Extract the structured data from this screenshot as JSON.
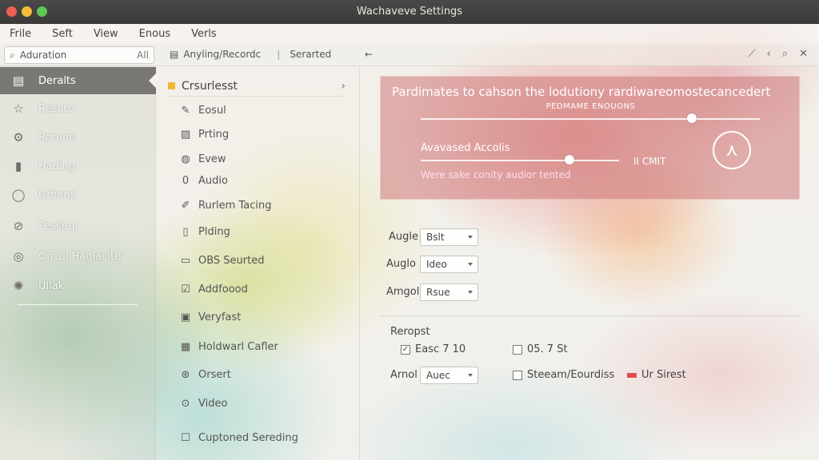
{
  "window": {
    "title": "Wachaveve Settings"
  },
  "menu": [
    "Frile",
    "Seft",
    "View",
    "Enous",
    "Verls"
  ],
  "toolbar": {
    "search_value": "Aduration",
    "search_scope": "All",
    "crumb1": "Anyling/Recordc",
    "crumb2": "Serarted"
  },
  "sidebar": {
    "items": [
      {
        "label": "Deralts",
        "icon": "list-icon"
      },
      {
        "label": "Resure",
        "icon": "star-icon"
      },
      {
        "label": "Rerune",
        "icon": "gear-icon"
      },
      {
        "label": "Hading",
        "icon": "clipboard-icon"
      },
      {
        "label": "Grhens",
        "icon": "circle-icon"
      },
      {
        "label": "Pessital",
        "icon": "compass-icon"
      },
      {
        "label": "Oncul Hagiacite",
        "icon": "dial-icon"
      },
      {
        "label": "Ullak",
        "icon": "sun-icon"
      }
    ]
  },
  "midlist": {
    "header": "Crsurlesst",
    "items": [
      {
        "label": "Eosul",
        "icon": "pen-icon"
      },
      {
        "label": "Prting",
        "icon": "image-icon"
      },
      {
        "label": "Evew",
        "icon": "globe-icon"
      },
      {
        "label": "Audio",
        "icon": "mic-icon"
      },
      {
        "label": "Rurlem Tacing",
        "icon": "brush-icon"
      },
      {
        "label": "Plding",
        "icon": "tag-icon"
      },
      {
        "label": "OBS Seurted",
        "icon": "obs-icon"
      },
      {
        "label": "Addfoood",
        "icon": "edit-icon"
      },
      {
        "label": "Veryfast",
        "icon": "layers-icon"
      },
      {
        "label": "Holdwarl Cafler",
        "icon": "grid-icon"
      },
      {
        "label": "Orsert",
        "icon": "badge-icon"
      },
      {
        "label": "Video",
        "icon": "video-icon"
      },
      {
        "label": "Cuptoned Sereding",
        "icon": "square-icon"
      }
    ]
  },
  "hero": {
    "title": "Pardimates to cahson the lodutiony rardiwareomostecancedert",
    "subtitle": "PEDMAME ENOUONS",
    "slider_label": "Avavased Accolis",
    "note": "Were sake conity audior tented",
    "limit": "II CMIT",
    "top_slider_level": 0.8,
    "bottom_slider_level": 0.75
  },
  "fields": [
    {
      "label": "Augle",
      "value": "Bslt"
    },
    {
      "label": "Auglo",
      "value": "Ideo"
    },
    {
      "label": "Amgol",
      "value": "Rsue"
    }
  ],
  "bottom": {
    "section": "Reropst",
    "check1": "Easc 7 10",
    "check1_mark": "✓",
    "check2": "05. 7 St",
    "field_label": "Arnol",
    "field_value": "Auec",
    "check3": "Steeam/Eourdiss",
    "flag_label": "Ur Sirest"
  }
}
